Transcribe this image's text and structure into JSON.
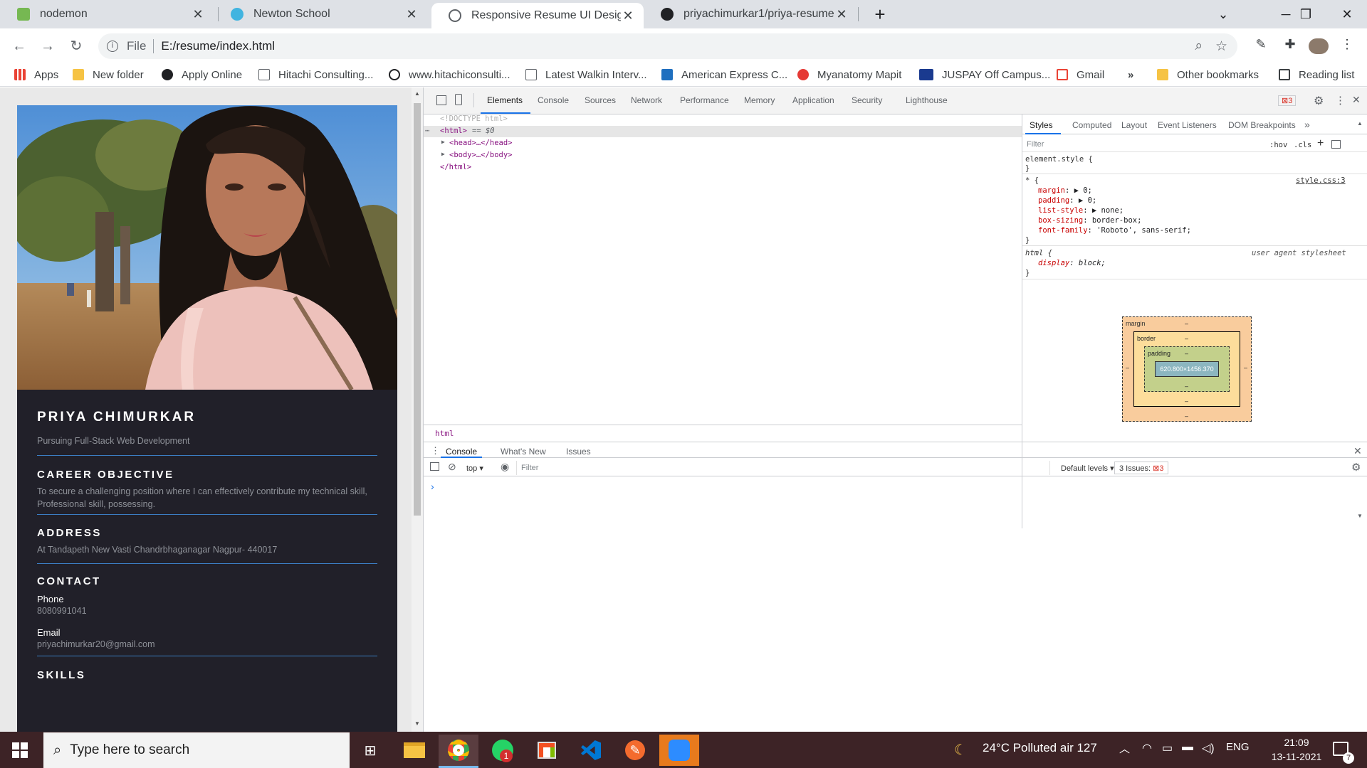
{
  "browser": {
    "tabs": [
      {
        "label": "nodemon",
        "icon": "nodemon-favicon",
        "color": "#76b852"
      },
      {
        "label": "Newton School",
        "icon": "newton-school-favicon",
        "color": "#41b4e0"
      },
      {
        "label": "Responsive Resume UI Design in",
        "icon": "globe-icon",
        "color": "#5f6368"
      },
      {
        "label": "priyachimurkar1/priya-resume",
        "icon": "github-icon",
        "color": "#202124"
      }
    ],
    "new_tab": "+",
    "close_glyph": "✕",
    "address": {
      "scheme": "File",
      "url": "E:/resume/index.html"
    },
    "bookmarks": [
      {
        "label": "Apps",
        "icon": "apps-grid-icon"
      },
      {
        "label": "New folder",
        "icon": "folder-icon"
      },
      {
        "label": "Apply Online",
        "icon": "globe-icon"
      },
      {
        "label": "Hitachi Consulting...",
        "icon": "page-icon"
      },
      {
        "label": "www.hitachiconsulti...",
        "icon": "globe-icon"
      },
      {
        "label": "Latest Walkin Interv...",
        "icon": "page-icon"
      },
      {
        "label": "American Express C...",
        "icon": "amex-icon"
      },
      {
        "label": "Myanatomy Mapit",
        "icon": "myanatomy-icon"
      },
      {
        "label": "JUSPAY Off Campus...",
        "icon": "fv-icon"
      },
      {
        "label": "Gmail",
        "icon": "gmail-icon"
      }
    ],
    "more_bookmarks": "»",
    "other_bookmarks": "Other bookmarks",
    "reading_list": "Reading list"
  },
  "resume": {
    "name": "PRIYA CHIMURKAR",
    "tagline": "Pursuing Full-Stack Web Development",
    "career_heading": "CAREER OBJECTIVE",
    "career_text": "To secure a challenging position where I can effectively contribute my technical skill, Professional skill, possessing.",
    "address_heading": "ADDRESS",
    "address_text": "At Tandapeth New Vasti Chandrbhaganagar Nagpur- 440017",
    "contact_heading": "CONTACT",
    "phone_label": "Phone",
    "phone": "8080991041",
    "email_label": "Email",
    "email": "priyachimurkar20@gmail.com",
    "skills_heading": "SKILLS"
  },
  "devtools": {
    "tabs": [
      "Elements",
      "Console",
      "Sources",
      "Network",
      "Performance",
      "Memory",
      "Application",
      "Security",
      "Lighthouse"
    ],
    "issues_badge": "3",
    "dom": {
      "doctype": "<!DOCTYPE html>",
      "html_open": "<html>",
      "selected_marker": "== $0",
      "head": "<head>…</head>",
      "body": "<body>…</body>",
      "html_close": "</html>"
    },
    "breadcrumb": "html",
    "styles_tabs": [
      "Styles",
      "Computed",
      "Layout",
      "Event Listeners",
      "DOM Breakpoints"
    ],
    "styles_more": "»",
    "filter_placeholder": "Filter",
    "hov": ":hov",
    "cls": ".cls",
    "plus": "+",
    "rules": {
      "element_style": "element.style {",
      "close": "}",
      "star_selector": "* {",
      "star_source": "style.css:3",
      "decls": [
        {
          "prop": "margin",
          "value": "▶ 0;"
        },
        {
          "prop": "padding",
          "value": "▶ 0;"
        },
        {
          "prop": "list-style",
          "value": "▶ none;"
        },
        {
          "prop": "box-sizing",
          "value": "border-box;"
        },
        {
          "prop": "font-family",
          "value": "'Roboto', sans-serif;"
        }
      ],
      "html_selector": "html {",
      "html_source": "user agent stylesheet",
      "html_decl_prop": "display",
      "html_decl_value": "block;"
    },
    "boxmodel": {
      "margin_label": "margin",
      "border_label": "border",
      "padding_label": "padding",
      "content_size": "620.800×1456.370",
      "dash": "–"
    },
    "drawer": {
      "tabs": [
        "Console",
        "What's New",
        "Issues"
      ],
      "context": "top",
      "filter_placeholder": "Filter",
      "levels": "Default levels",
      "issues_label": "3 Issues:",
      "issues_count": "3",
      "prompt": "›"
    }
  },
  "taskbar": {
    "search_placeholder": "Type here to search",
    "weather": "24°C  Polluted air 127",
    "lang": "ENG",
    "time": "21:09",
    "date": "13-11-2021",
    "whatsapp_badge": "1",
    "notif_count": "7"
  }
}
